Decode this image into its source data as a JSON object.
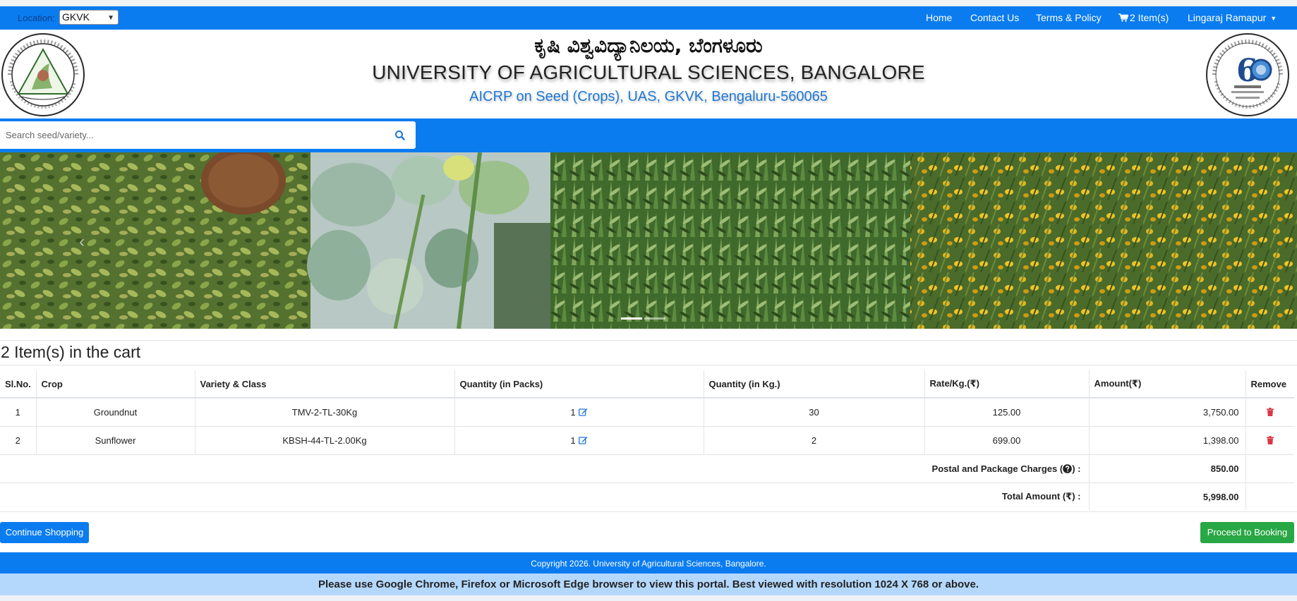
{
  "navbar": {
    "location_label": "Location:",
    "location_value": "GKVK",
    "links": {
      "home": "Home",
      "contact": "Contact Us",
      "terms": "Terms & Policy",
      "cart": "2 Item(s)",
      "user": "Lingaraj Ramapur"
    }
  },
  "header": {
    "title_kannada": "ಕೃಷಿ ವಿಶ್ವವಿದ್ಯಾನಿಲಯ, ಬೆಂಗಳೂರು",
    "title_english": "UNIVERSITY OF AGRICULTURAL SCIENCES, BANGALORE",
    "subtitle": "AICRP on Seed (Crops), UAS, GKVK, Bengaluru-560065",
    "logo_left_text": "UNIVERSITY OF AGRICULTURAL SCIENCES, BANGALORE",
    "logo_right_text": "60 DIAMOND JUBILEE CELEBRATION 1964-2024"
  },
  "search": {
    "placeholder": "Search seed/variety..."
  },
  "cart": {
    "heading": "2 Item(s) in the cart",
    "columns": [
      "Sl.No.",
      "Crop",
      "Variety & Class",
      "Quantity (in Packs)",
      "Quantity (in Kg.)",
      "Rate/Kg.(₹)",
      "Amount(₹)",
      "Remove"
    ],
    "rows": [
      {
        "sl": "1",
        "crop": "Groundnut",
        "variety": "TMV-2-TL-30Kg",
        "packs": "1",
        "kg": "30",
        "rate": "125.00",
        "amount": "3,750.00"
      },
      {
        "sl": "2",
        "crop": "Sunflower",
        "variety": "KBSH-44-TL-2.00Kg",
        "packs": "1",
        "kg": "2",
        "rate": "699.00",
        "amount": "1,398.00"
      }
    ],
    "postal_label": "Postal and Package Charges (",
    "postal_label_end": ") :",
    "postal_value": "850.00",
    "total_label": "Total Amount (₹) :",
    "total_value": "5,998.00"
  },
  "buttons": {
    "continue": "Continue Shopping",
    "proceed": "Proceed to Booking"
  },
  "footer": {
    "copyright": "Copyright 2026. University of Agricultural Sciences, Bangalore.",
    "browser_note": "Please use Google Chrome, Firefox or Microsoft Edge browser to view this portal. Best viewed with resolution 1024 X 768 or above."
  },
  "colors": {
    "primary": "#0a7cf0",
    "success": "#28a745",
    "danger": "#dc3545",
    "note_bg": "#b4d8fc"
  },
  "icons": [
    "cart-icon",
    "search-icon",
    "edit-icon",
    "trash-icon",
    "question-circle-icon",
    "chevron-left-icon",
    "caret-down-icon"
  ]
}
